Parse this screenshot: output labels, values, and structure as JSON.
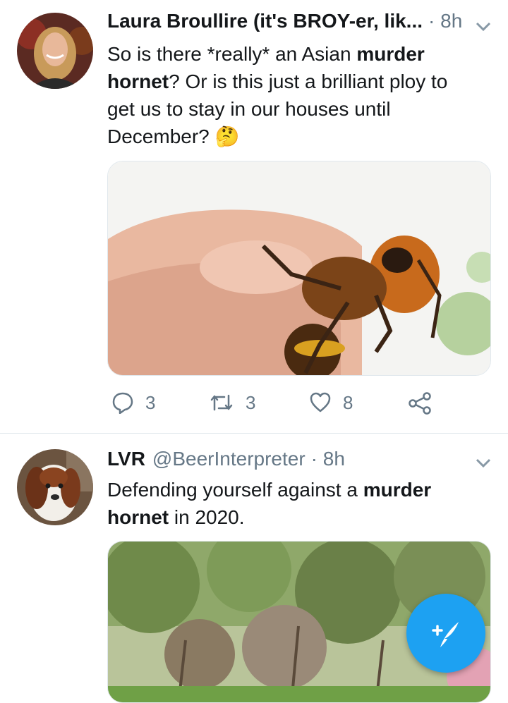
{
  "tweets": [
    {
      "name": "Laura Broullire (it's BROY-er, lik...",
      "handle": "",
      "time": "· 8h",
      "text_parts": [
        "So is there *really* an Asian ",
        "murder",
        " ",
        "hornet",
        "? Or is this just a brilliant ploy to get us to stay in our houses until December?"
      ],
      "emoji": "🤔",
      "replies": "3",
      "retweets": "3",
      "likes": "8"
    },
    {
      "name": "LVR",
      "handle": "@BeerInterpreter",
      "time": "· 8h",
      "text_parts": [
        "Defending yourself against a ",
        "murder",
        " ",
        "hornet",
        " in 2020."
      ]
    }
  ],
  "icons": {
    "reply": "reply-icon",
    "retweet": "retweet-icon",
    "like": "heart-icon",
    "share": "share-icon",
    "compose": "compose-tweet-icon",
    "caret": "chevron-down-icon"
  },
  "colors": {
    "accent": "#1da1f2",
    "secondary_text": "#657786",
    "divider": "#e1e8ed"
  }
}
